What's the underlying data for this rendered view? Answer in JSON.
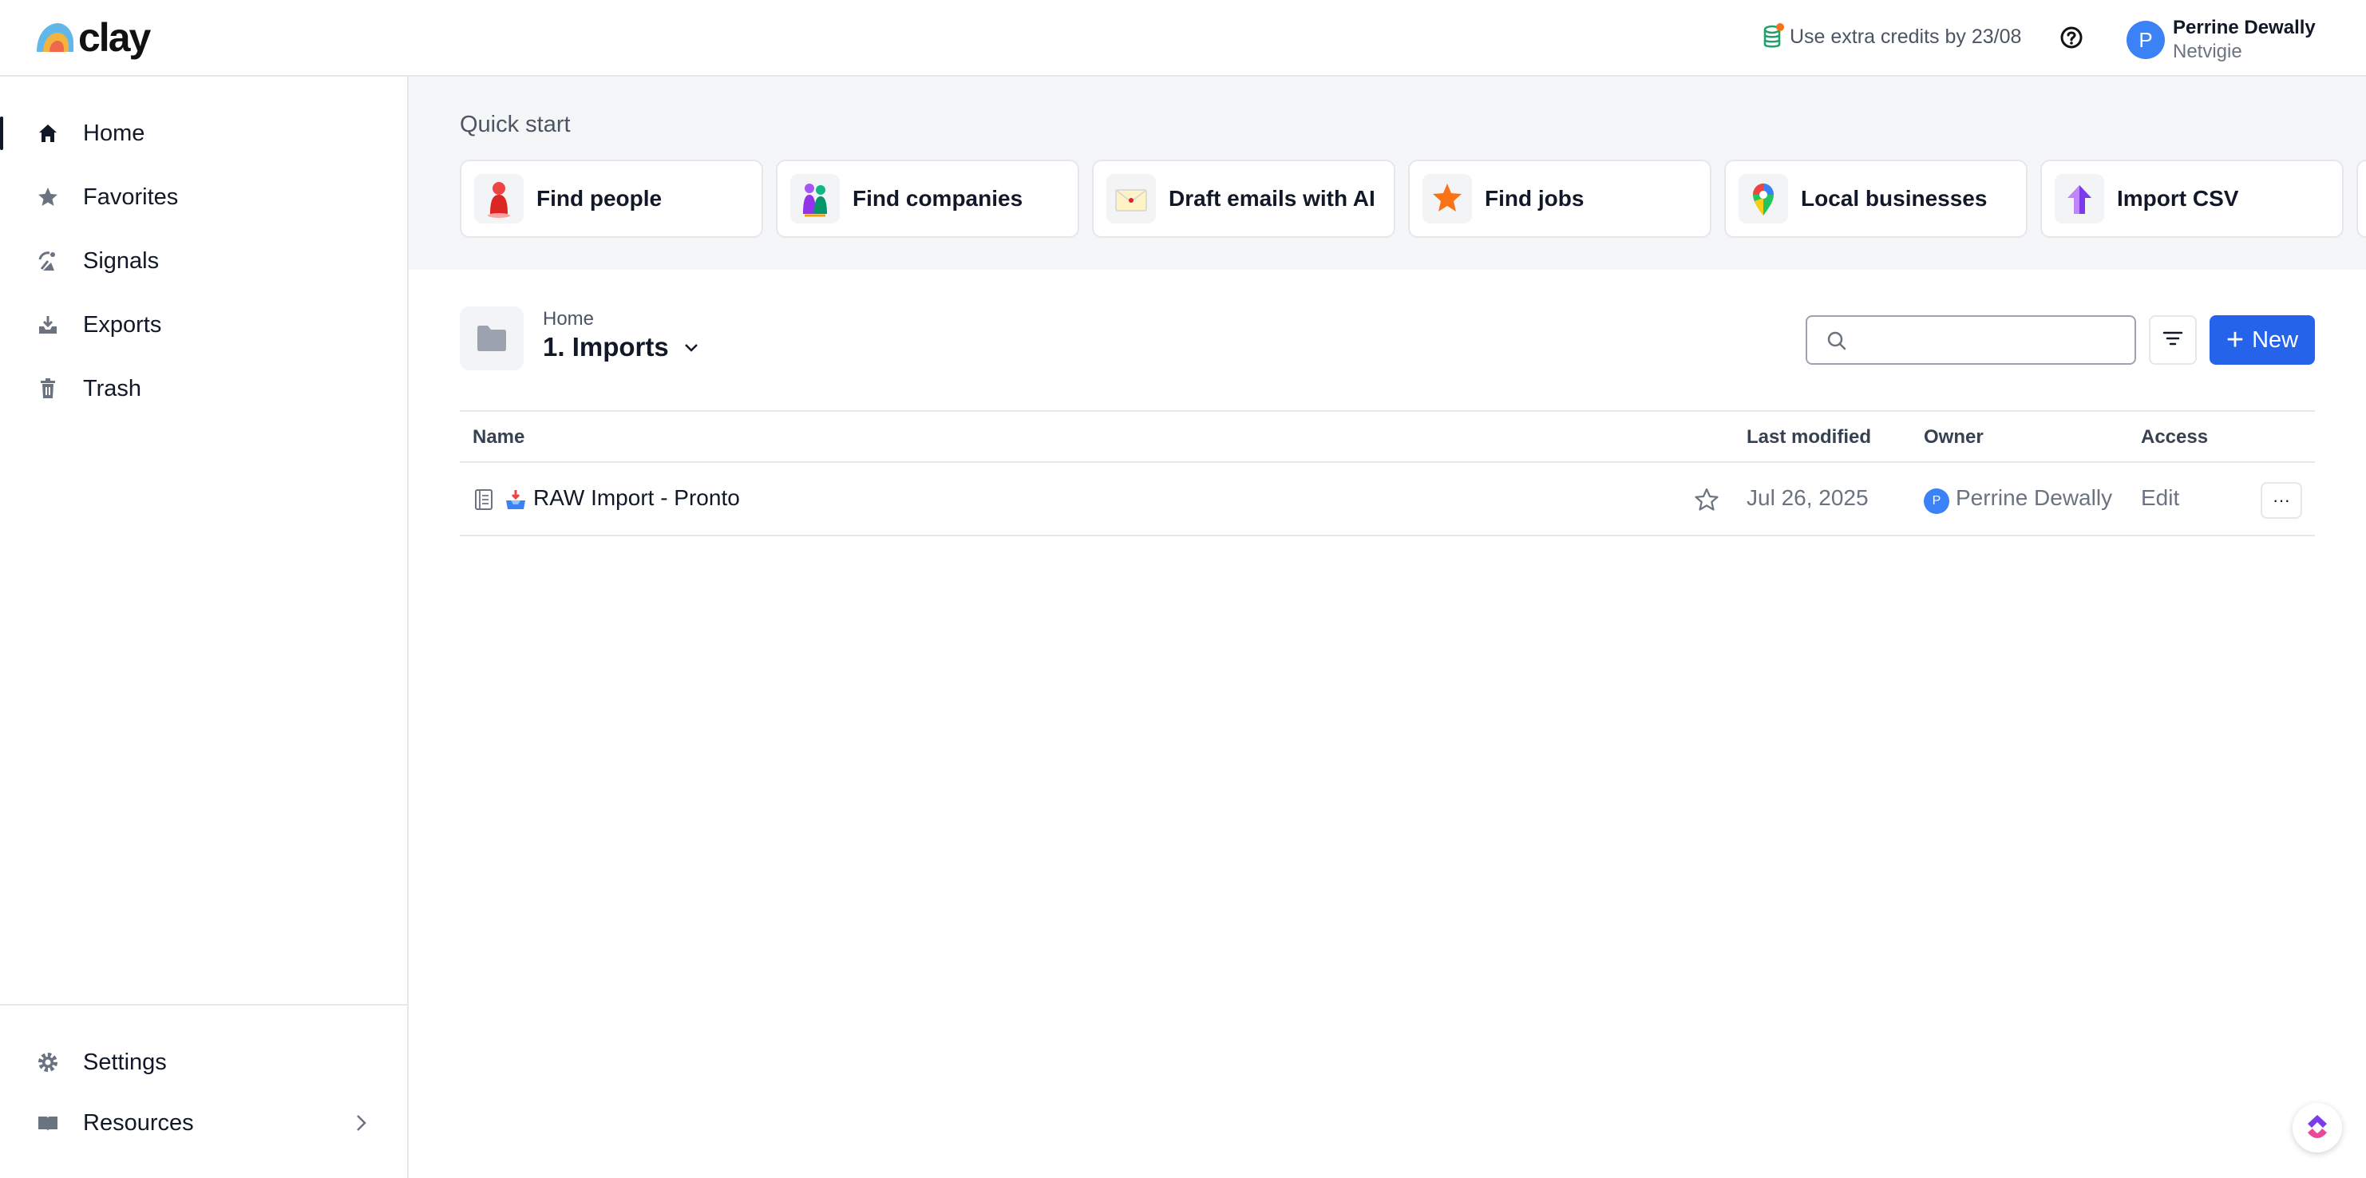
{
  "app": {
    "logo_text": "clay"
  },
  "topbar": {
    "credits_text": "Use extra credits by 23/08",
    "user": {
      "initial": "P",
      "name": "Perrine Dewally",
      "org": "Netvigie"
    }
  },
  "sidebar": {
    "items": [
      {
        "label": "Home",
        "icon": "home-icon",
        "active": true
      },
      {
        "label": "Favorites",
        "icon": "star-icon"
      },
      {
        "label": "Signals",
        "icon": "signal-icon"
      },
      {
        "label": "Exports",
        "icon": "export-icon"
      },
      {
        "label": "Trash",
        "icon": "trash-icon"
      }
    ],
    "bottom_items": [
      {
        "label": "Settings",
        "icon": "gear-icon"
      },
      {
        "label": "Resources",
        "icon": "book-icon"
      }
    ]
  },
  "quickstart": {
    "title": "Quick start",
    "cards": [
      {
        "label": "Find people",
        "icon": "person-icon"
      },
      {
        "label": "Find companies",
        "icon": "people-group-icon"
      },
      {
        "label": "Draft emails with AI",
        "icon": "envelope-icon"
      },
      {
        "label": "Find jobs",
        "icon": "star-badge-icon"
      },
      {
        "label": "Local businesses",
        "icon": "map-pin-icon"
      },
      {
        "label": "Import CSV",
        "icon": "upload-arrow-icon"
      }
    ]
  },
  "folder": {
    "breadcrumb": "Home",
    "title": "1. Imports"
  },
  "search": {
    "placeholder": ""
  },
  "toolbar": {
    "new_label": "New"
  },
  "table": {
    "headers": {
      "name": "Name",
      "last_modified": "Last modified",
      "owner": "Owner",
      "access": "Access"
    },
    "rows": [
      {
        "name": "RAW Import - Pronto",
        "last_modified": "Jul 26, 2025",
        "owner_initial": "P",
        "owner": "Perrine Dewally",
        "access": "Edit",
        "more": "···"
      }
    ]
  },
  "colors": {
    "accent": "#2563eb",
    "avatar": "#3b82f6"
  }
}
